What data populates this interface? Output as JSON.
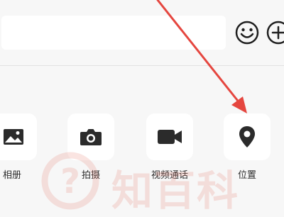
{
  "input": {
    "value": ""
  },
  "top_icons": {
    "emoji": "emoji-icon",
    "add": "plus-circle-icon"
  },
  "actions": [
    {
      "label": "相册",
      "icon": "gallery-icon"
    },
    {
      "label": "拍摄",
      "icon": "camera-icon"
    },
    {
      "label": "视频通话",
      "icon": "video-call-icon"
    },
    {
      "label": "位置",
      "icon": "location-pin-icon"
    }
  ],
  "watermark": {
    "text": "知百科"
  },
  "colors": {
    "background": "#f7f7f7",
    "tile": "#ffffff",
    "icon": "#2b2b2b",
    "arrow": "#e5463f",
    "watermark": "#e88278"
  }
}
